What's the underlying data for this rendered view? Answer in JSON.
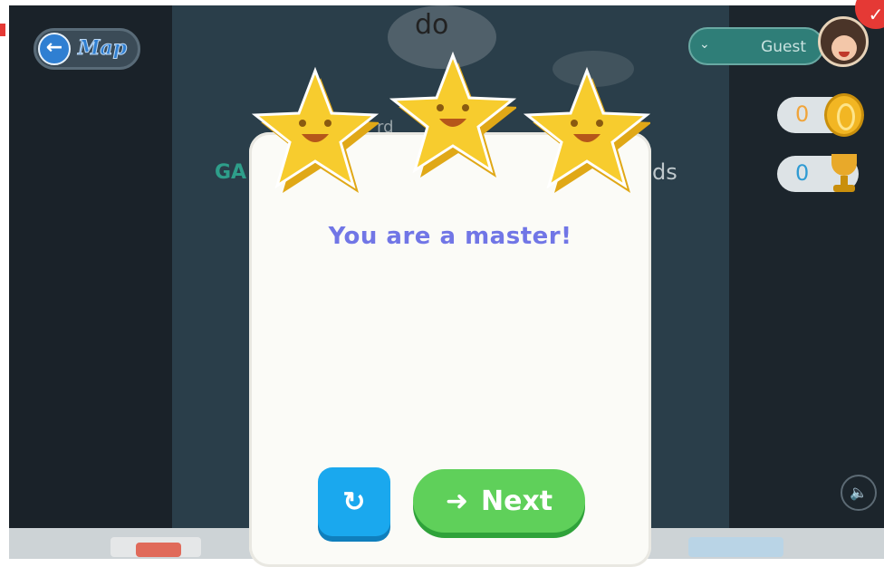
{
  "header": {
    "word": "do",
    "map_button": {
      "icon": "back-arrow-icon",
      "label": "Map"
    },
    "user": {
      "name": "Guest",
      "dropdown_icon": "chevron-down-icon"
    }
  },
  "counters": {
    "coins": {
      "value": "0",
      "icon": "coin-icon"
    },
    "trophies": {
      "value": "0",
      "icon": "trophy-icon"
    }
  },
  "background_text": {
    "left": "GA",
    "right": "ds",
    "top": "rd"
  },
  "result_modal": {
    "stars_earned": 3,
    "stars_total": 3,
    "message": "You are a master!",
    "replay_icon": "replay-icon",
    "next_label": "Next",
    "next_icon": "right-arrow-icon"
  },
  "sound_icon": "speaker-icon",
  "colors": {
    "title": "#7176e6",
    "next_button": "#5fd05a",
    "replay_button": "#1aa8ee",
    "star": "#f5c518"
  }
}
